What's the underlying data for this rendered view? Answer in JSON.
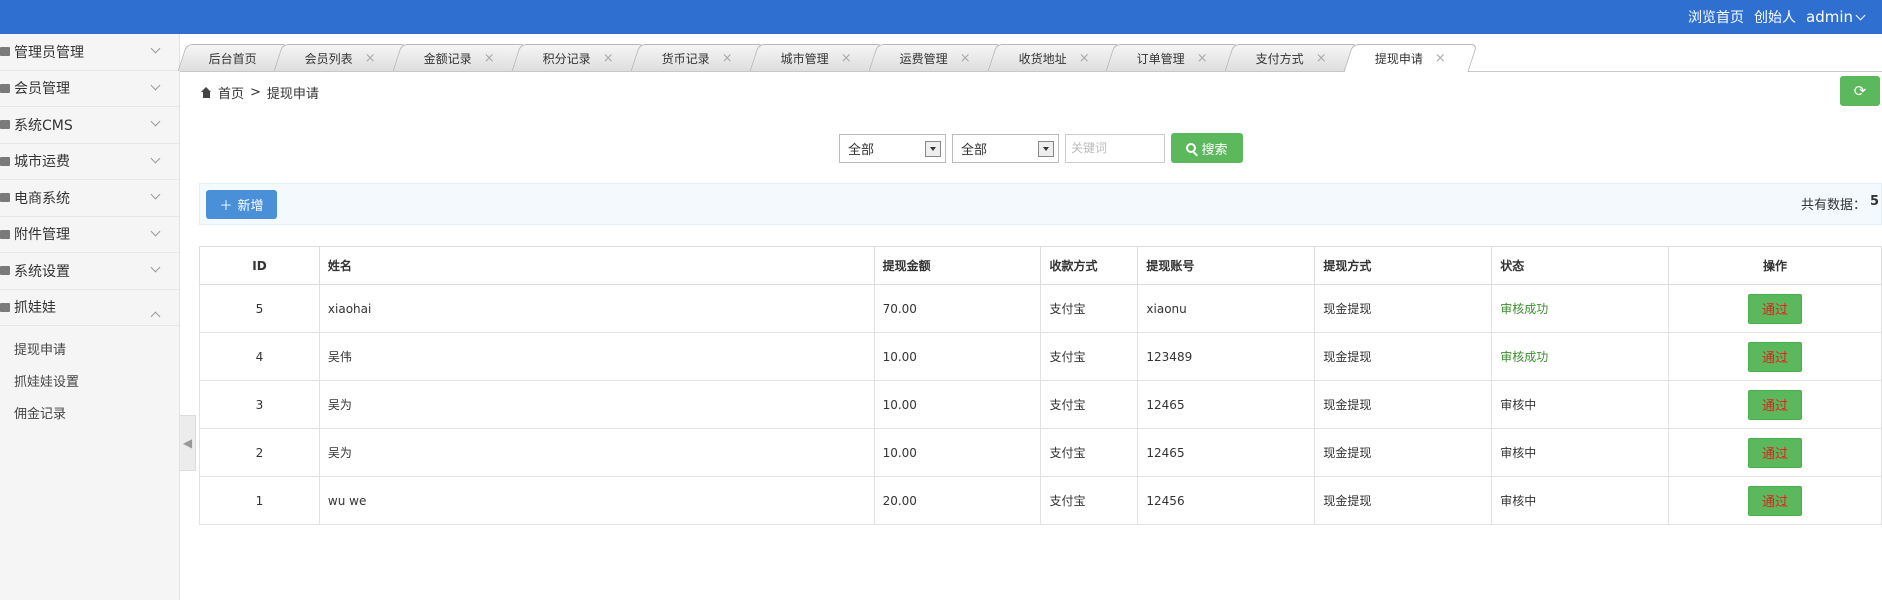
{
  "header": {
    "browse_home": "浏览首页",
    "founder": "创始人",
    "user": "admin"
  },
  "sidebar": {
    "items": [
      {
        "label": "管理员管理"
      },
      {
        "label": "会员管理"
      },
      {
        "label": "系统CMS"
      },
      {
        "label": "城市运费"
      },
      {
        "label": "电商系统"
      },
      {
        "label": "附件管理"
      },
      {
        "label": "系统设置"
      },
      {
        "label": "抓娃娃"
      }
    ],
    "sub_items": [
      {
        "label": "提现申请"
      },
      {
        "label": "抓娃娃设置"
      },
      {
        "label": "佣金记录"
      }
    ]
  },
  "tabs": [
    {
      "label": "后台首页",
      "closable": false
    },
    {
      "label": "会员列表",
      "closable": true
    },
    {
      "label": "金额记录",
      "closable": true
    },
    {
      "label": "积分记录",
      "closable": true
    },
    {
      "label": "货币记录",
      "closable": true
    },
    {
      "label": "城市管理",
      "closable": true
    },
    {
      "label": "运费管理",
      "closable": true
    },
    {
      "label": "收货地址",
      "closable": true
    },
    {
      "label": "订单管理",
      "closable": true
    },
    {
      "label": "支付方式",
      "closable": true
    },
    {
      "label": "提现申请",
      "closable": true,
      "active": true
    }
  ],
  "breadcrumb": {
    "home": "首页",
    "separator": ">",
    "current": "提现申请"
  },
  "filters": {
    "select1": "全部",
    "select2": "全部",
    "keyword_placeholder": "关键词",
    "search_label": "搜索"
  },
  "toolbar": {
    "add_label": "新增",
    "total_label": "共有数据：",
    "total_count": "5"
  },
  "table": {
    "headers": [
      "ID",
      "姓名",
      "提现金额",
      "收款方式",
      "提现账号",
      "提现方式",
      "状态",
      "操作"
    ],
    "rows": [
      {
        "id": "5",
        "name": "xiaohai",
        "amount": "70.00",
        "method": "支付宝",
        "account": "xiaonu",
        "type": "现金提现",
        "status": "审核成功",
        "action": "通过"
      },
      {
        "id": "4",
        "name": "吴伟",
        "amount": "10.00",
        "method": "支付宝",
        "account": "123489",
        "type": "现金提现",
        "status": "审核成功",
        "action": "通过"
      },
      {
        "id": "3",
        "name": "吴为",
        "amount": "10.00",
        "method": "支付宝",
        "account": "12465",
        "type": "现金提现",
        "status": "审核中",
        "action": "通过"
      },
      {
        "id": "2",
        "name": "吴为",
        "amount": "10.00",
        "method": "支付宝",
        "account": "12465",
        "type": "现金提现",
        "status": "审核中",
        "action": "通过"
      },
      {
        "id": "1",
        "name": "wu we",
        "amount": "20.00",
        "method": "支付宝",
        "account": "12456",
        "type": "现金提现",
        "status": "审核中",
        "action": "通过"
      }
    ]
  },
  "colors": {
    "topbar": "#2f6fcf",
    "success": "#5cb85c",
    "primary": "#4a90d9",
    "status_ok": "#3c8d2f",
    "action_text": "#e02020"
  },
  "icons": {
    "home": "home-icon",
    "search": "magnifier-icon",
    "refresh": "refresh-icon",
    "add": "plus-icon",
    "dropdown": "chevron-down-icon",
    "close": "close-icon"
  }
}
